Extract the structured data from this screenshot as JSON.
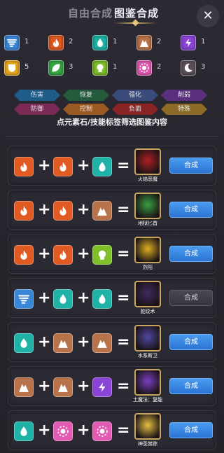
{
  "header": {
    "tab_free": "自由合成",
    "tab_catalog": "图鉴合成",
    "close_glyph": "✕"
  },
  "elements": [
    {
      "icon": "tornado-icon",
      "color": "#3a86d8",
      "count": "1"
    },
    {
      "icon": "fire-icon",
      "color": "#e05a22",
      "count": "2"
    },
    {
      "icon": "water-drop-icon",
      "color": "#1fb2a6",
      "count": "1"
    },
    {
      "icon": "mountain-icon",
      "color": "#b8734a",
      "count": "2"
    },
    {
      "icon": "lightning-icon",
      "color": "#8a45d6",
      "count": "1"
    },
    {
      "icon": "shield-icon",
      "color": "#e9a81e",
      "count": "5"
    },
    {
      "icon": "leaf-icon",
      "color": "#36a844",
      "count": "3"
    },
    {
      "icon": "skull-icon",
      "color": "#7fbf2a",
      "count": "1"
    },
    {
      "icon": "sun-flower-icon",
      "color": "#e35ab2",
      "count": "2"
    },
    {
      "icon": "crescent-moon-icon",
      "color": "#5c5058",
      "count": "3"
    }
  ],
  "tags": [
    {
      "label": "伤害",
      "color": "#1f5c88"
    },
    {
      "label": "恢复",
      "color": "#245b3c"
    },
    {
      "label": "强化",
      "color": "#3a4a7a"
    },
    {
      "label": "削弱",
      "color": "#5a2f7e"
    },
    {
      "label": "防御",
      "color": "#7a2a55"
    },
    {
      "label": "控制",
      "color": "#9a5a22"
    },
    {
      "label": "负面",
      "color": "#8a2424"
    },
    {
      "label": "特殊",
      "color": "#8a6a24"
    }
  ],
  "hint": "点元素石/技能标签筛选图鉴内容",
  "recipes": [
    {
      "inputs": [
        "fire",
        "fire",
        "water"
      ],
      "result_name": "火焰恶魔",
      "result_color": "#b02020",
      "button": "合成",
      "enabled": true
    },
    {
      "inputs": [
        "fire",
        "fire",
        "earth"
      ],
      "result_name": "地狱匕首",
      "result_color": "#3aa040",
      "button": "合成",
      "enabled": true
    },
    {
      "inputs": [
        "fire",
        "fire",
        "poison"
      ],
      "result_name": "烈阳",
      "result_color": "#e0b020",
      "button": "合成",
      "enabled": true
    },
    {
      "inputs": [
        "wind",
        "water",
        "water"
      ],
      "result_name": "蛇纹术",
      "result_color": "#402a60",
      "button": "合成",
      "enabled": false
    },
    {
      "inputs": [
        "water",
        "earth",
        "earth"
      ],
      "result_name": "水系斯卫",
      "result_color": "#5048a0",
      "button": "合成",
      "enabled": true
    },
    {
      "inputs": [
        "earth",
        "earth",
        "thunder"
      ],
      "result_name": "土魔法：复能",
      "result_color": "#7a40c0",
      "button": "合成",
      "enabled": true
    },
    {
      "inputs": [
        "water",
        "light",
        "light"
      ],
      "result_name": "神圣禁踪",
      "result_color": "#e8c040",
      "button": "合成",
      "enabled": true
    }
  ],
  "recipe_symbols": {
    "plus": "+",
    "equals": "="
  }
}
